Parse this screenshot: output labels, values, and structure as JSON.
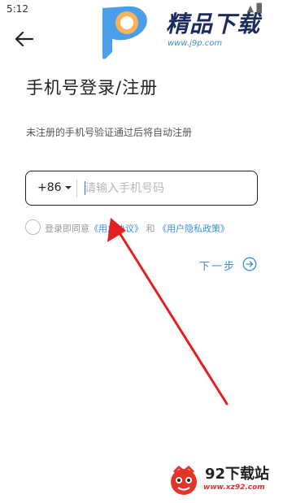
{
  "status_bar": {
    "time": "5:12",
    "icons": "▲ ▊"
  },
  "watermark_top": {
    "brand": "精品下载",
    "url": "www.j9p.com"
  },
  "page": {
    "title": "手机号登录/注册",
    "subtitle": "未注册的手机号验证通过后将自动注册"
  },
  "phone": {
    "country_code": "+86",
    "value": "",
    "placeholder": "请输入手机号码"
  },
  "agreement": {
    "prefix": "登录即同意",
    "user_agreement": "《用户协议》",
    "and": "和",
    "privacy_policy": "《用户隐私政策》",
    "checked": false
  },
  "next": {
    "label": "下一步"
  },
  "watermark_bottom": {
    "name": "92下载站",
    "url": "www.xz92.com"
  },
  "colors": {
    "accent": "#3b8fe0",
    "annotation": "#e41f1f",
    "text": "#222222",
    "muted": "#999999"
  }
}
